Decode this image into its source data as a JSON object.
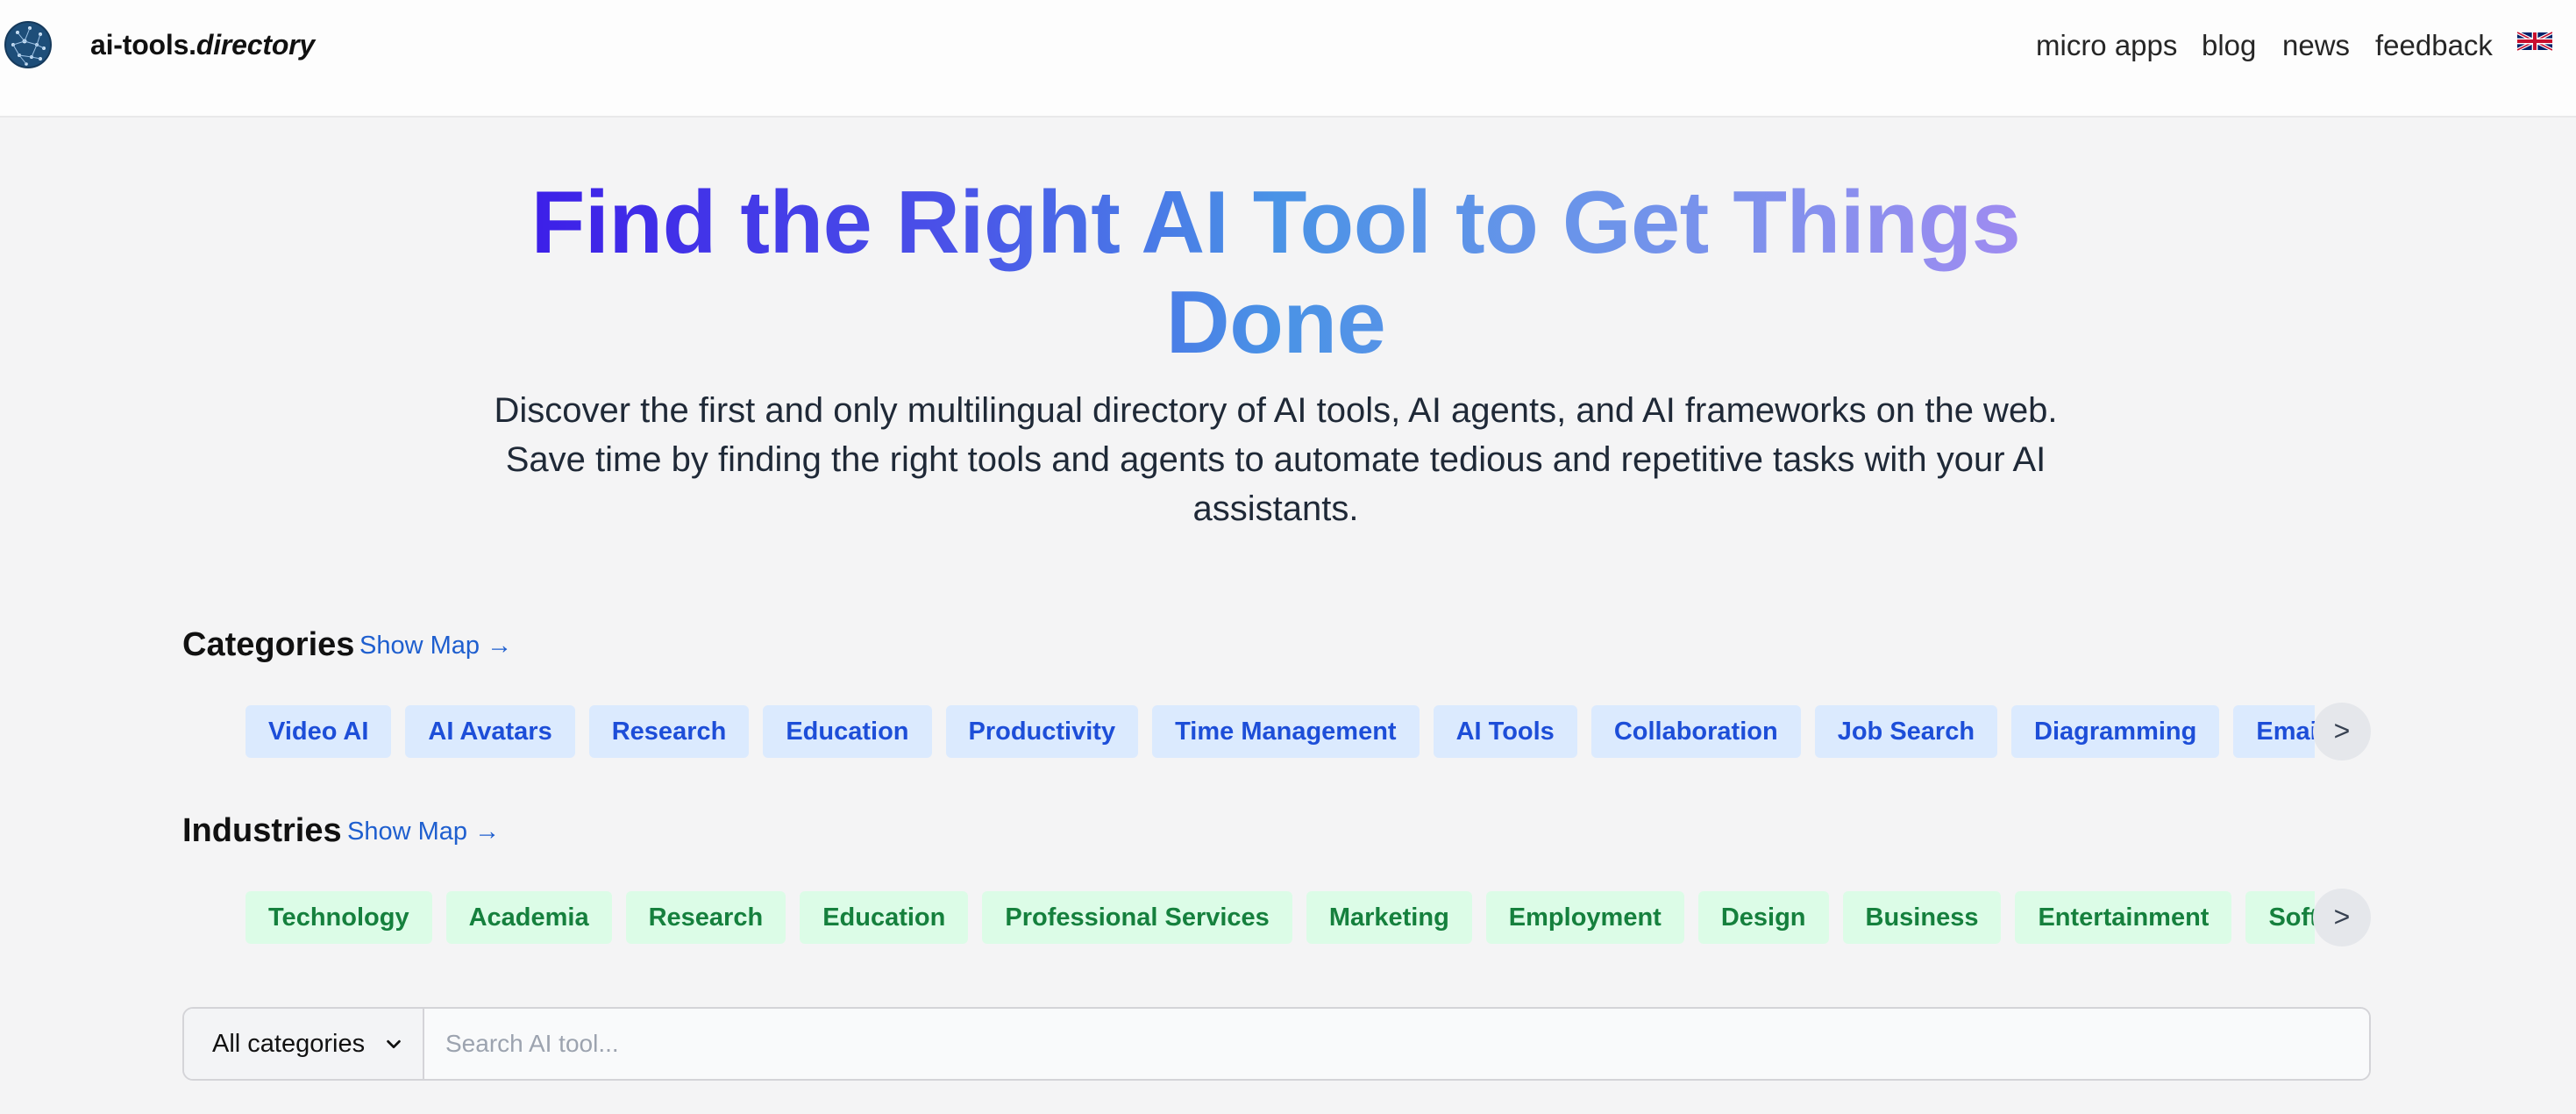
{
  "brand": {
    "name": "ai-tools.",
    "name_italic": "directory"
  },
  "nav": {
    "items": [
      "micro apps",
      "blog",
      "news",
      "feedback"
    ]
  },
  "hero": {
    "title": "Find the Right AI Tool to Get Things Done",
    "subtitle": "Discover the first and only multilingual directory of AI tools, AI agents, and AI frameworks on the web. Save time by finding the right tools and agents to automate tedious and repetitive tasks with your AI assistants."
  },
  "categories": {
    "title": "Categories",
    "show_map": "Show Map →",
    "chips": [
      "Video AI",
      "AI Avatars",
      "Research",
      "Education",
      "Productivity",
      "Time Management",
      "AI Tools",
      "Collaboration",
      "Job Search",
      "Diagramming",
      "Email Ma"
    ],
    "scroll": ">"
  },
  "industries": {
    "title": "Industries",
    "show_map": "Show Map →",
    "chips": [
      "Technology",
      "Academia",
      "Research",
      "Education",
      "Professional Services",
      "Marketing",
      "Employment",
      "Design",
      "Business",
      "Entertainment",
      "Softwar"
    ],
    "scroll": ">"
  },
  "search": {
    "category_value": "All categories",
    "placeholder": "Search AI tool..."
  },
  "colors": {
    "chip_blue_bg": "#dbeafe",
    "chip_blue_text": "#1d4ed8",
    "chip_green_bg": "#dcfce7",
    "chip_green_text": "#15803d",
    "link": "#1f5fcf"
  },
  "icons": {
    "logo": "globe-network-icon",
    "flag": "uk-flag-icon",
    "chevron": "chevron-down-icon"
  }
}
